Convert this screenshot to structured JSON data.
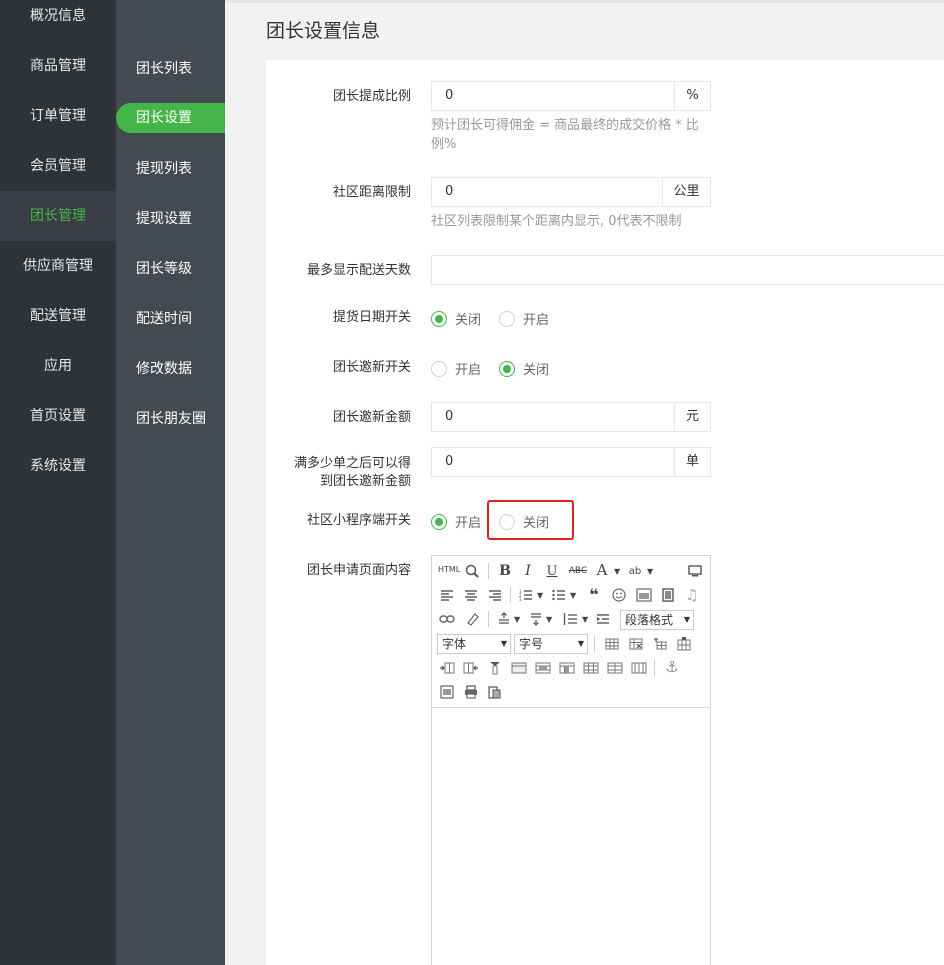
{
  "nav1": [
    "概况信息",
    "商品管理",
    "订单管理",
    "会员管理",
    "团长管理",
    "供应商管理",
    "配送管理",
    "应用",
    "首页设置",
    "系统设置"
  ],
  "nav2": [
    "团长列表",
    "团长设置",
    "提现列表",
    "提现设置",
    "团长等级",
    "配送时间",
    "修改数据",
    "团长朋友圈"
  ],
  "page_title": "团长设置信息",
  "form": {
    "commission_label": "团长提成比例",
    "commission_value": "0",
    "commission_unit": "%",
    "commission_help": "预计团长可得佣金 = 商品最终的成交价格 * 比例%",
    "distance_label": "社区距离限制",
    "distance_value": "0",
    "distance_unit": "公里",
    "distance_help": "社区列表限制某个距离内显示, 0代表不限制",
    "max_days_label": "最多显示配送天数",
    "max_days_value": "",
    "pickup_label": "提货日期开关",
    "pickup_opt1": "关闭",
    "pickup_opt2": "开启",
    "invite_label": "团长邀新开关",
    "invite_opt1": "开启",
    "invite_opt2": "关闭",
    "invite_amount_label": "团长邀新金额",
    "invite_amount_value": "0",
    "invite_amount_unit": "元",
    "orders_label_line1": "满多少单之后可以得",
    "orders_label_line2": "到团长邀新金额",
    "orders_value": "0",
    "orders_unit": "单",
    "miniapp_label": "社区小程序端开关",
    "miniapp_opt1": "开启",
    "miniapp_opt2": "关闭",
    "content_label": "团长申请页面内容"
  },
  "editor": {
    "html": "HTML",
    "paragraph": "段落格式",
    "font": "字体",
    "size": "字号"
  },
  "colors": {
    "accent": "#44b549",
    "highlight": "#e02020"
  }
}
